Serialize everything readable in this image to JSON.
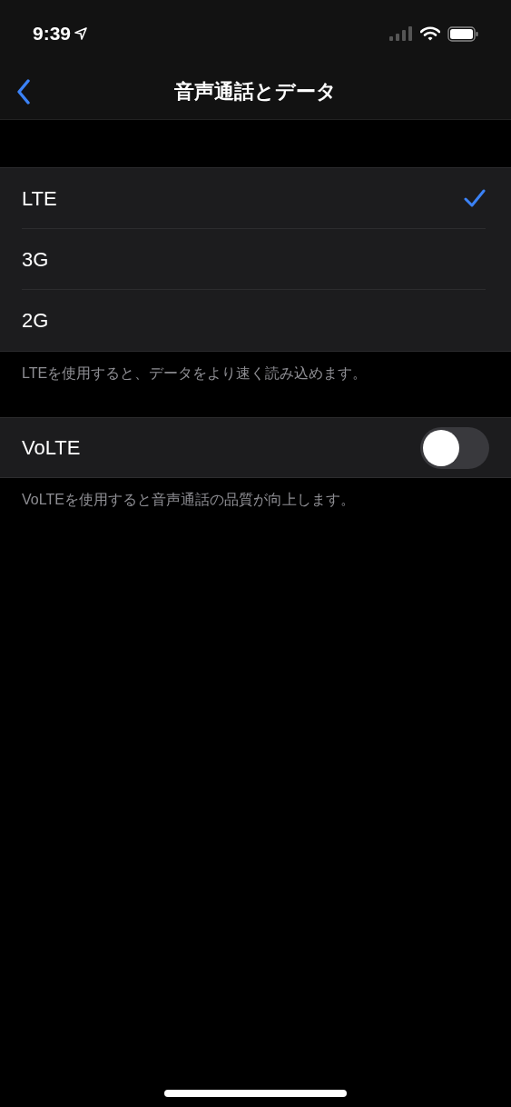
{
  "status_bar": {
    "time": "9:39"
  },
  "nav": {
    "title": "音声通話とデータ"
  },
  "network_options": [
    {
      "label": "LTE",
      "selected": true
    },
    {
      "label": "3G",
      "selected": false
    },
    {
      "label": "2G",
      "selected": false
    }
  ],
  "network_footer": "LTEを使用すると、データをより速く読み込めます。",
  "volte": {
    "label": "VoLTE",
    "on": false
  },
  "volte_footer": "VoLTEを使用すると音声通話の品質が向上します。"
}
